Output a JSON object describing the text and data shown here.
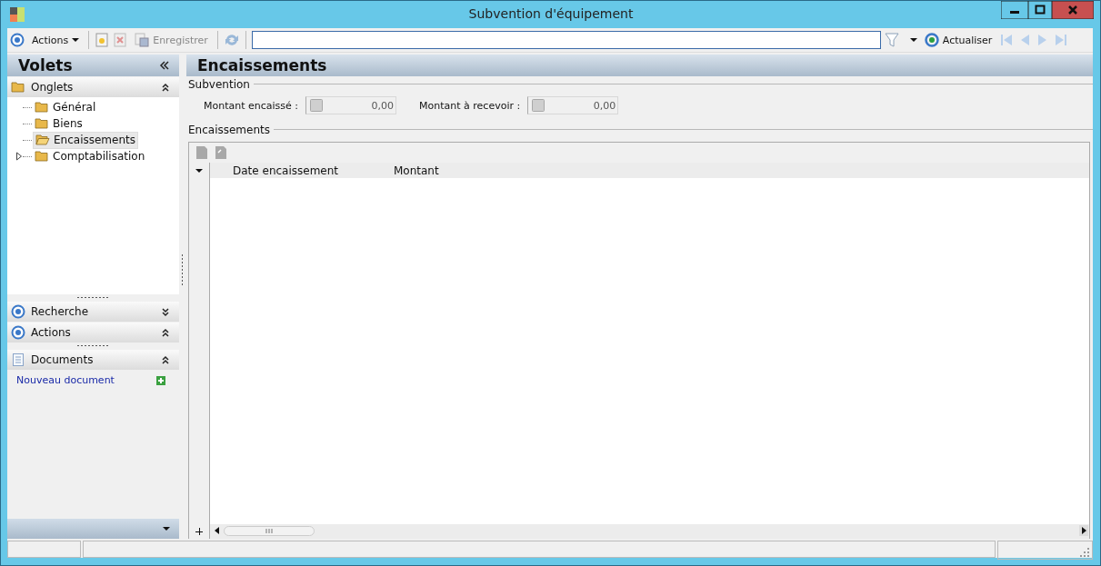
{
  "window": {
    "title": "Subvention d'équipement"
  },
  "toolbar": {
    "actions_menu": "Actions",
    "save": "Enregistrer",
    "refresh": "Actualiser"
  },
  "sidebar": {
    "title": "Volets",
    "tabs_panel": {
      "title": "Onglets",
      "expanded": true,
      "items": [
        {
          "label": "Général",
          "selected": false,
          "expandable": false
        },
        {
          "label": "Biens",
          "selected": false,
          "expandable": false
        },
        {
          "label": "Encaissements",
          "selected": true,
          "expandable": false
        },
        {
          "label": "Comptabilisation",
          "selected": false,
          "expandable": true
        }
      ]
    },
    "panels": [
      {
        "kind": "search",
        "title": "Recherche",
        "expanded": false
      },
      {
        "kind": "actions",
        "title": "Actions",
        "expanded": true
      },
      {
        "kind": "documents",
        "title": "Documents",
        "expanded": true,
        "link": "Nouveau document"
      }
    ]
  },
  "main": {
    "title": "Encaissements",
    "subvention": {
      "legend": "Subvention",
      "fields": [
        {
          "label": "Montant encaissé :",
          "value": "0,00"
        },
        {
          "label": "Montant à recevoir :",
          "value": "0,00"
        }
      ]
    },
    "encaissements": {
      "legend": "Encaissements",
      "columns": [
        "Date encaissement",
        "Montant"
      ]
    }
  }
}
